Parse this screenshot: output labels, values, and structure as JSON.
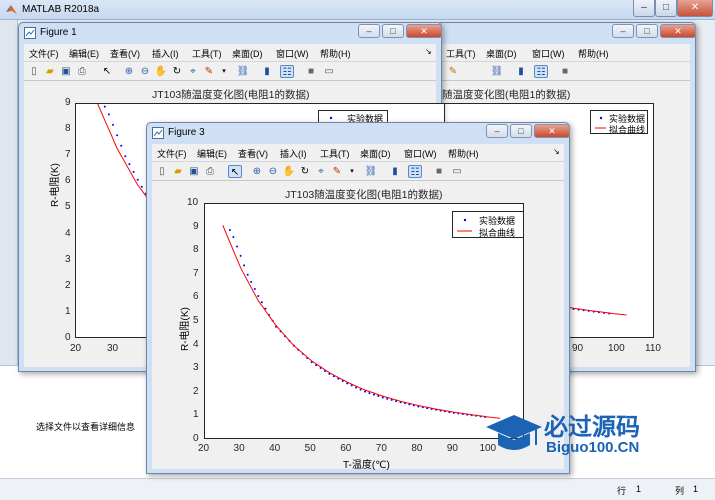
{
  "matlab": {
    "title": "MATLAB R2018a"
  },
  "file_info": "选择文件以查看详细信息",
  "status": {
    "row_label": "行",
    "row_value": "1",
    "col_label": "列",
    "col_value": "1"
  },
  "figure1": {
    "title": "Figure 1",
    "menus": [
      "文件(F)",
      "编辑(E)",
      "查看(V)",
      "插入(I)",
      "工具(T)",
      "桌面(D)",
      "窗口(W)",
      "帮助(H)"
    ],
    "plot_title": "JT103随温度变化图(电阻1的数据)",
    "ylabel": "R-电阻(K)",
    "yticks": [
      "0",
      "1",
      "2",
      "3",
      "4",
      "5",
      "6",
      "7",
      "8",
      "9"
    ],
    "xticks_left": [
      "20",
      "30"
    ],
    "legend": [
      "实验数据",
      "拟合曲线"
    ]
  },
  "figure2": {
    "menus": [
      "工具(T)",
      "桌面(D)",
      "窗口(W)",
      "帮助(H)"
    ],
    "plot_title_fragment": "随温度变化图(电阻1的数据)",
    "xticks_right": [
      "90",
      "100",
      "110"
    ],
    "legend": [
      "实验数据",
      "拟合曲线"
    ]
  },
  "figure3": {
    "title": "Figure 3",
    "menus": [
      "文件(F)",
      "编辑(E)",
      "查看(V)",
      "插入(I)",
      "工具(T)",
      "桌面(D)",
      "窗口(W)",
      "帮助(H)"
    ],
    "plot_title": "JT103随温度变化图(电阻1的数据)",
    "ylabel": "R-电阻(K)",
    "xlabel": "T-温度(℃)",
    "yticks": [
      "0",
      "1",
      "2",
      "3",
      "4",
      "5",
      "6",
      "7",
      "8",
      "9",
      "10"
    ],
    "xticks": [
      "20",
      "30",
      "40",
      "50",
      "60",
      "70",
      "80",
      "90",
      "100"
    ],
    "legend": [
      "实验数据",
      "拟合曲线"
    ]
  },
  "watermark": {
    "text1": "必过源码",
    "text2": "Biguo100.CN"
  },
  "chart_data": {
    "type": "line",
    "title": "JT103随温度变化图(电阻1的数据)",
    "xlabel": "T-温度(℃)",
    "ylabel": "R-电阻(K)",
    "xlim": [
      20,
      110
    ],
    "ylim": [
      0,
      10
    ],
    "series": [
      {
        "name": "实验数据",
        "style": "points",
        "color": "#0000ff",
        "x": [
          27,
          28,
          30,
          32,
          35,
          38,
          40,
          45,
          50,
          55,
          60,
          65,
          70,
          75,
          80,
          85,
          90,
          95,
          100
        ],
        "y": [
          8.9,
          8.6,
          7.8,
          7.0,
          6.1,
          5.3,
          4.8,
          4.0,
          3.3,
          2.8,
          2.4,
          2.05,
          1.8,
          1.6,
          1.42,
          1.28,
          1.15,
          1.05,
          0.95
        ]
      },
      {
        "name": "拟合曲线",
        "style": "line",
        "color": "#ff0000",
        "x": [
          25,
          30,
          35,
          40,
          45,
          50,
          55,
          60,
          65,
          70,
          75,
          80,
          85,
          90,
          95,
          100,
          103
        ],
        "y": [
          9.1,
          7.3,
          5.9,
          4.85,
          4.0,
          3.35,
          2.85,
          2.45,
          2.12,
          1.86,
          1.64,
          1.46,
          1.31,
          1.18,
          1.07,
          0.97,
          0.92
        ]
      }
    ]
  }
}
